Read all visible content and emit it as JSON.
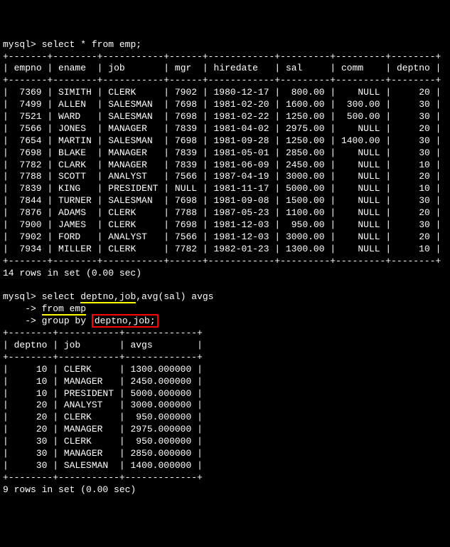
{
  "query1": {
    "prompt": "mysql>",
    "sql": "select * from emp;",
    "columns": [
      "empno",
      "ename",
      "job",
      "mgr",
      "hiredate",
      "sal",
      "comm",
      "deptno"
    ],
    "rows": [
      [
        "7369",
        "SIMITH",
        "CLERK",
        "7902",
        "1980-12-17",
        "800.00",
        "NULL",
        "20"
      ],
      [
        "7499",
        "ALLEN",
        "SALESMAN",
        "7698",
        "1981-02-20",
        "1600.00",
        "300.00",
        "30"
      ],
      [
        "7521",
        "WARD",
        "SALESMAN",
        "7698",
        "1981-02-22",
        "1250.00",
        "500.00",
        "30"
      ],
      [
        "7566",
        "JONES",
        "MANAGER",
        "7839",
        "1981-04-02",
        "2975.00",
        "NULL",
        "20"
      ],
      [
        "7654",
        "MARTIN",
        "SALESMAN",
        "7698",
        "1981-09-28",
        "1250.00",
        "1400.00",
        "30"
      ],
      [
        "7698",
        "BLAKE",
        "MANAGER",
        "7839",
        "1981-05-01",
        "2850.00",
        "NULL",
        "30"
      ],
      [
        "7782",
        "CLARK",
        "MANAGER",
        "7839",
        "1981-06-09",
        "2450.00",
        "NULL",
        "10"
      ],
      [
        "7788",
        "SCOTT",
        "ANALYST",
        "7566",
        "1987-04-19",
        "3000.00",
        "NULL",
        "20"
      ],
      [
        "7839",
        "KING",
        "PRESIDENT",
        "NULL",
        "1981-11-17",
        "5000.00",
        "NULL",
        "10"
      ],
      [
        "7844",
        "TURNER",
        "SALESMAN",
        "7698",
        "1981-09-08",
        "1500.00",
        "NULL",
        "30"
      ],
      [
        "7876",
        "ADAMS",
        "CLERK",
        "7788",
        "1987-05-23",
        "1100.00",
        "NULL",
        "20"
      ],
      [
        "7900",
        "JAMES",
        "CLERK",
        "7698",
        "1981-12-03",
        "950.00",
        "NULL",
        "30"
      ],
      [
        "7902",
        "FORD",
        "ANALYST",
        "7566",
        "1981-12-03",
        "3000.00",
        "NULL",
        "20"
      ],
      [
        "7934",
        "MILLER",
        "CLERK",
        "7782",
        "1982-01-23",
        "1300.00",
        "NULL",
        "10"
      ]
    ],
    "footer": "14 rows in set (0.00 sec)"
  },
  "query2": {
    "prompt": "mysql>",
    "cont": "    ->",
    "line1_a": "select ",
    "line1_b": "deptno,job",
    "line1_c": ",avg(sal) avgs",
    "line2": "from emp",
    "line3_a": "group by ",
    "line3_b": "deptno,job;",
    "columns": [
      "deptno",
      "job",
      "avgs"
    ],
    "rows": [
      [
        "10",
        "CLERK",
        "1300.000000"
      ],
      [
        "10",
        "MANAGER",
        "2450.000000"
      ],
      [
        "10",
        "PRESIDENT",
        "5000.000000"
      ],
      [
        "20",
        "ANALYST",
        "3000.000000"
      ],
      [
        "20",
        "CLERK",
        "950.000000"
      ],
      [
        "20",
        "MANAGER",
        "2975.000000"
      ],
      [
        "30",
        "CLERK",
        "950.000000"
      ],
      [
        "30",
        "MANAGER",
        "2850.000000"
      ],
      [
        "30",
        "SALESMAN",
        "1400.000000"
      ]
    ],
    "footer": "9 rows in set (0.00 sec)"
  }
}
